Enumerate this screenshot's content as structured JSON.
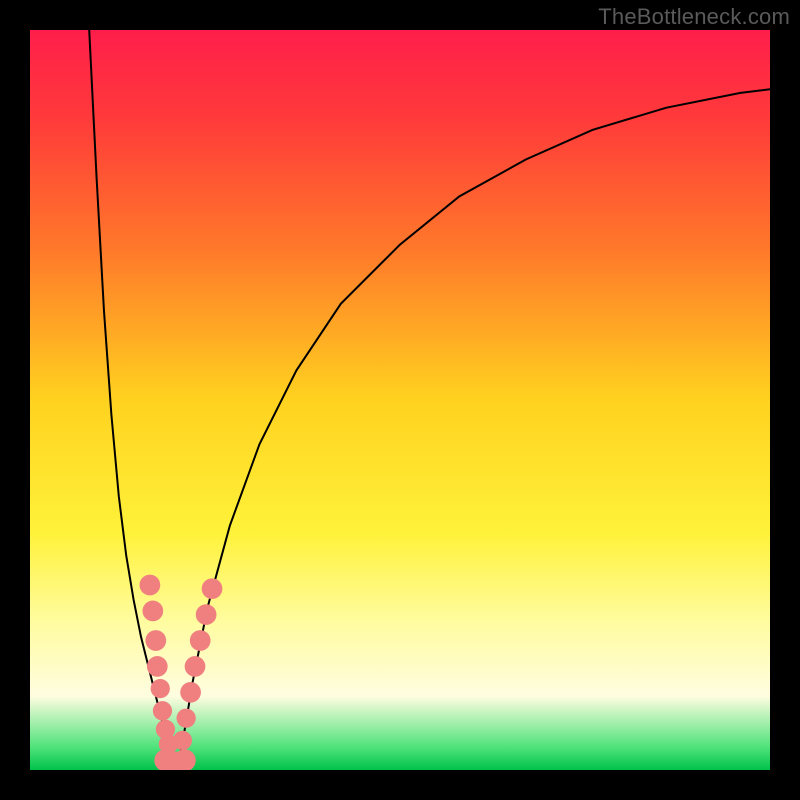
{
  "watermark": "TheBottleneck.com",
  "chart_data": {
    "type": "line",
    "title": "",
    "xlabel": "",
    "ylabel": "",
    "xlim": [
      0,
      100
    ],
    "ylim": [
      0,
      100
    ],
    "grid": false,
    "legend": false,
    "gradient_stops": [
      {
        "offset": 0.0,
        "color": "#ff1e4b"
      },
      {
        "offset": 0.12,
        "color": "#ff3a3a"
      },
      {
        "offset": 0.3,
        "color": "#ff7a2a"
      },
      {
        "offset": 0.5,
        "color": "#ffd21f"
      },
      {
        "offset": 0.68,
        "color": "#fff23a"
      },
      {
        "offset": 0.8,
        "color": "#fffca0"
      },
      {
        "offset": 0.9,
        "color": "#fffde0"
      },
      {
        "offset": 0.97,
        "color": "#4de27a"
      },
      {
        "offset": 1.0,
        "color": "#00c24a"
      }
    ],
    "series": [
      {
        "name": "left-branch",
        "x": [
          8,
          9,
          10,
          11,
          12,
          13,
          14,
          15,
          16,
          17,
          18,
          18.8
        ],
        "y": [
          100,
          80,
          62,
          48,
          37,
          29,
          23,
          18,
          14,
          10,
          6,
          1.5
        ]
      },
      {
        "name": "right-branch",
        "x": [
          20.2,
          21,
          22,
          24,
          27,
          31,
          36,
          42,
          50,
          58,
          67,
          76,
          86,
          96,
          100
        ],
        "y": [
          1.5,
          6,
          12,
          22,
          33,
          44,
          54,
          63,
          71,
          77.5,
          82.5,
          86.5,
          89.5,
          91.5,
          92
        ]
      },
      {
        "name": "valley-floor",
        "x": [
          18.8,
          19.5,
          20.2
        ],
        "y": [
          1.5,
          0.5,
          1.5
        ]
      }
    ],
    "markers": {
      "name": "highlight-points",
      "color": "#f08080",
      "points": [
        {
          "x": 16.2,
          "y": 25.0,
          "r": 1.4
        },
        {
          "x": 16.6,
          "y": 21.5,
          "r": 1.4
        },
        {
          "x": 17.0,
          "y": 17.5,
          "r": 1.4
        },
        {
          "x": 17.2,
          "y": 14.0,
          "r": 1.4
        },
        {
          "x": 17.6,
          "y": 11.0,
          "r": 1.3
        },
        {
          "x": 17.9,
          "y": 8.0,
          "r": 1.3
        },
        {
          "x": 18.3,
          "y": 5.5,
          "r": 1.3
        },
        {
          "x": 18.7,
          "y": 3.5,
          "r": 1.3
        },
        {
          "x": 18.3,
          "y": 1.3,
          "r": 1.5
        },
        {
          "x": 19.6,
          "y": 1.0,
          "r": 1.5
        },
        {
          "x": 20.9,
          "y": 1.3,
          "r": 1.5
        },
        {
          "x": 20.6,
          "y": 4.0,
          "r": 1.3
        },
        {
          "x": 21.1,
          "y": 7.0,
          "r": 1.3
        },
        {
          "x": 21.7,
          "y": 10.5,
          "r": 1.4
        },
        {
          "x": 22.3,
          "y": 14.0,
          "r": 1.4
        },
        {
          "x": 23.0,
          "y": 17.5,
          "r": 1.4
        },
        {
          "x": 23.8,
          "y": 21.0,
          "r": 1.4
        },
        {
          "x": 24.6,
          "y": 24.5,
          "r": 1.4
        }
      ]
    }
  }
}
